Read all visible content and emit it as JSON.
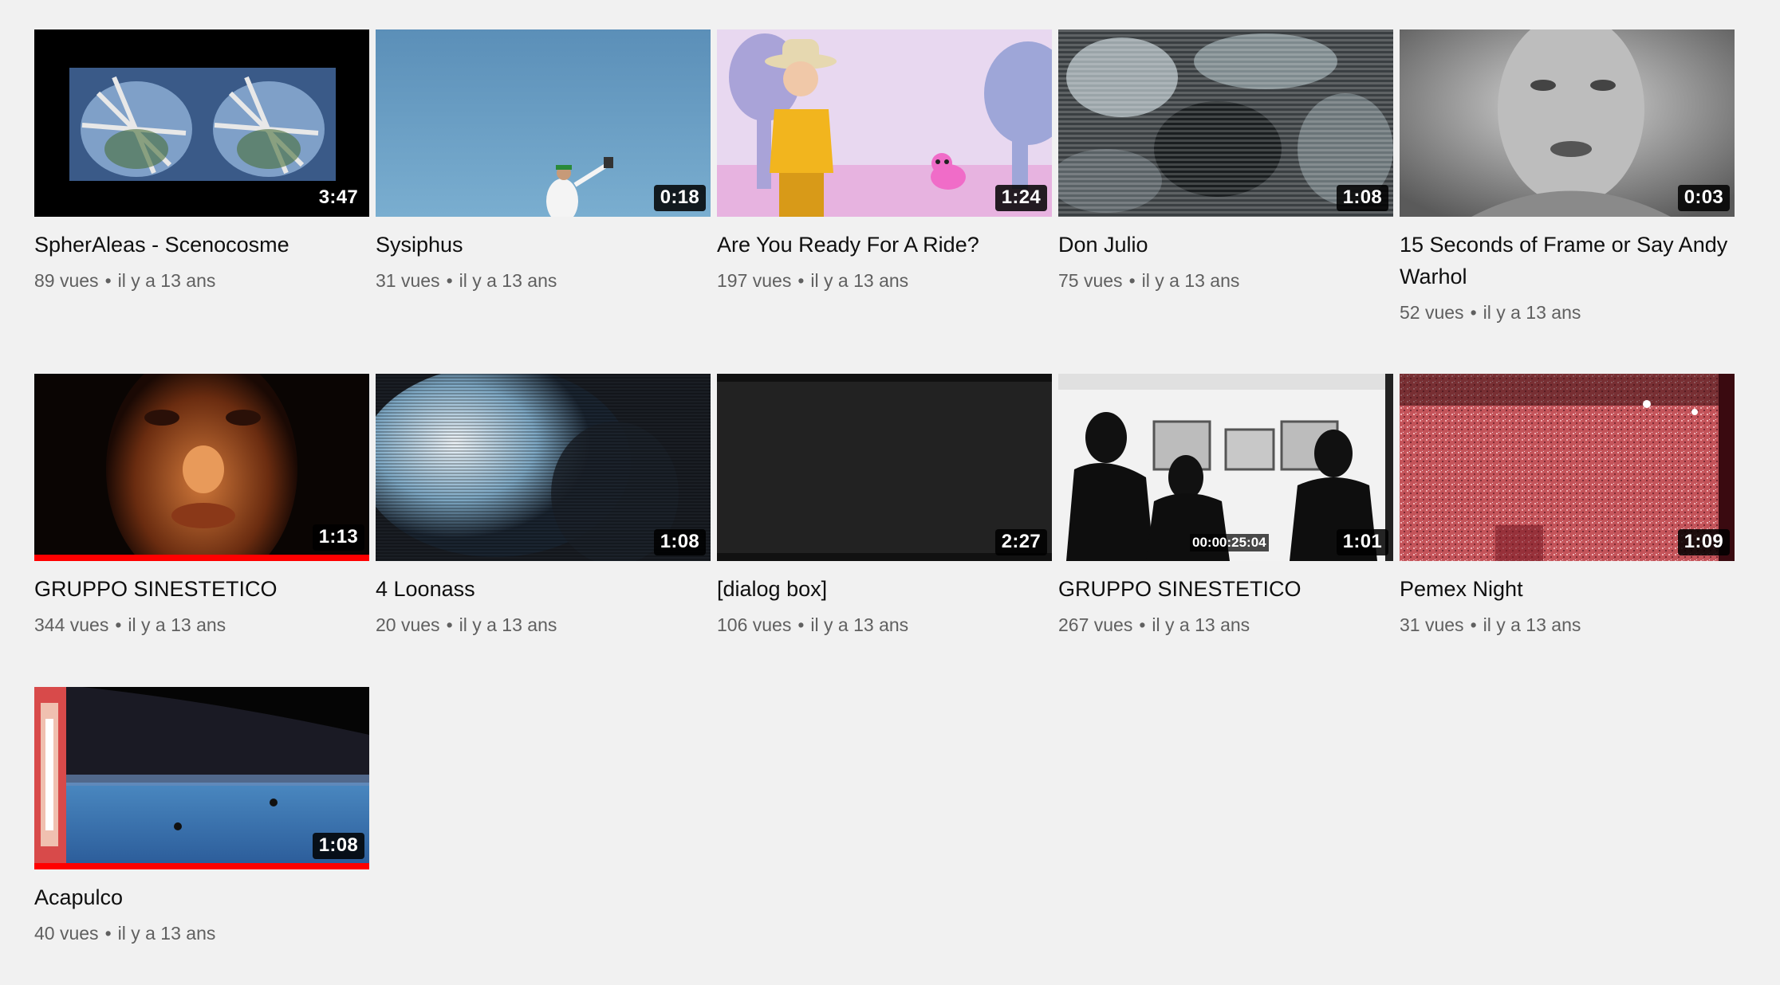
{
  "videos": [
    {
      "title": "SpherAleas - Scenocosme",
      "views": "89 vues",
      "age": "il y a 13 ans",
      "duration": "3:47",
      "progress": 0
    },
    {
      "title": "Sysiphus",
      "views": "31 vues",
      "age": "il y a 13 ans",
      "duration": "0:18",
      "progress": 0
    },
    {
      "title": "Are You Ready For A Ride?",
      "views": "197 vues",
      "age": "il y a 13 ans",
      "duration": "1:24",
      "progress": 0
    },
    {
      "title": "Don Julio",
      "views": "75 vues",
      "age": "il y a 13 ans",
      "duration": "1:08",
      "progress": 0
    },
    {
      "title": "15 Seconds of Frame or Say Andy Warhol",
      "views": "52 vues",
      "age": "il y a 13 ans",
      "duration": "0:03",
      "progress": 0
    },
    {
      "title": "GRUPPO SINESTETICO",
      "views": "344 vues",
      "age": "il y a 13 ans",
      "duration": "1:13",
      "progress": 1
    },
    {
      "title": "4 Loonass",
      "views": "20 vues",
      "age": "il y a 13 ans",
      "duration": "1:08",
      "progress": 0
    },
    {
      "title": "[dialog box]",
      "views": "106 vues",
      "age": "il y a 13 ans",
      "duration": "2:27",
      "progress": 0
    },
    {
      "title": "GRUPPO SINESTETICO",
      "views": "267 vues",
      "age": "il y a 13 ans",
      "duration": "1:01",
      "progress": 0,
      "overlay_text": "00:00:25:04"
    },
    {
      "title": "Pemex Night",
      "views": "31 vues",
      "age": "il y a 13 ans",
      "duration": "1:09",
      "progress": 0
    },
    {
      "title": "Acapulco",
      "views": "40 vues",
      "age": "il y a 13 ans",
      "duration": "1:08",
      "progress": 1
    }
  ],
  "separator": "•",
  "colors": {
    "progress": "#ff0000",
    "background": "#f1f1f1",
    "title": "#0f0f0f",
    "meta": "#606060"
  }
}
